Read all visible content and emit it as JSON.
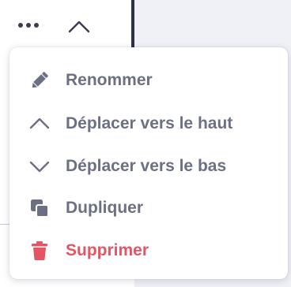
{
  "colors": {
    "text_muted": "#6c7083",
    "danger": "#e45463",
    "panel_bg": "#f0f1f6",
    "divider": "#2f3149",
    "toolbar_icon": "#3a3d52"
  },
  "toolbar": {
    "more_icon": "more-horizontal-icon",
    "collapse_icon": "chevron-up-icon"
  },
  "menu": {
    "items": [
      {
        "label": "Renommer",
        "icon": "pencil-icon"
      },
      {
        "label": "Déplacer vers le haut",
        "icon": "chevron-up-icon"
      },
      {
        "label": "Déplacer vers le bas",
        "icon": "chevron-down-icon"
      },
      {
        "label": "Dupliquer",
        "icon": "duplicate-icon"
      },
      {
        "label": "Supprimer",
        "icon": "trash-icon",
        "danger": true
      }
    ]
  }
}
